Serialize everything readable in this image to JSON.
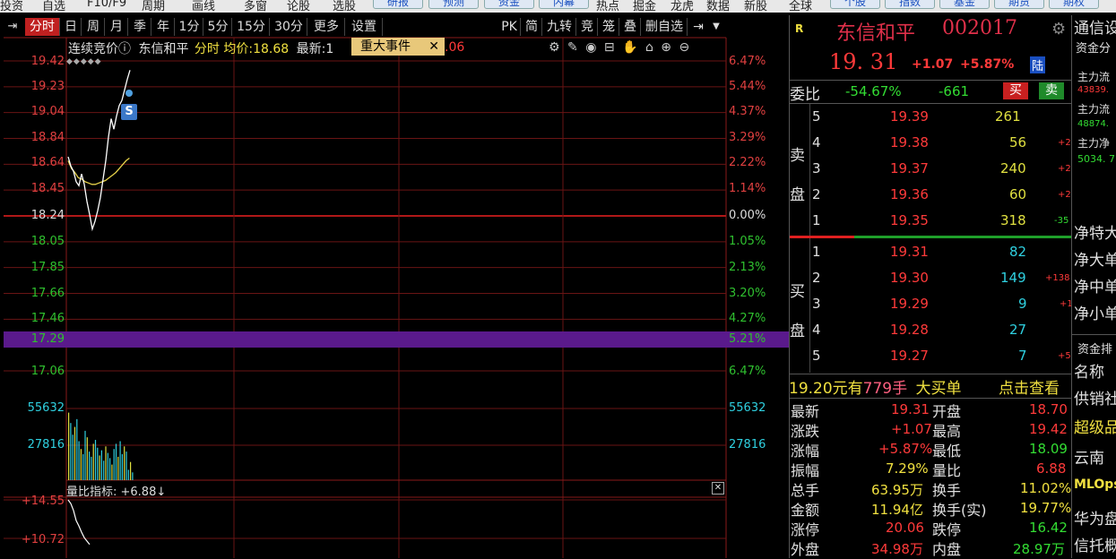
{
  "top_menu": [
    "投资",
    "自选",
    "F10/F9",
    "周期",
    "画线",
    "多窗",
    "论股",
    "选股",
    "研报",
    "预测",
    "资金",
    "内幕",
    "热点",
    "掘金",
    "龙虎",
    "数据",
    "新股",
    "全球",
    "个股",
    "指数",
    "基金",
    "期货",
    "期权"
  ],
  "toolbar": {
    "pin_icon": "pin-icon",
    "items": [
      "分时",
      "日",
      "周",
      "月",
      "季",
      "年",
      "1分",
      "5分",
      "15分",
      "30分",
      "更多",
      "设置"
    ],
    "right_items": [
      "PK",
      "简",
      "九转",
      "竞",
      "笼",
      "叠",
      "删自选"
    ],
    "export_icon": "export-icon",
    "dropdown_icon": "chevron-down-icon"
  },
  "chart_header": {
    "mode_label": "连续竞价",
    "name": "东信和平",
    "period": "分时",
    "avg_label": "均价:",
    "avg_value": "18.68",
    "latest_label": "最新:",
    "latest_value": "1",
    "event_label": "重大事件",
    "tail_value": ".06"
  },
  "chart_tools": [
    "gear-icon",
    "pen-icon",
    "eye-icon",
    "lock-open-icon",
    "hand-icon",
    "lock-icon",
    "zoom-in-icon",
    "zoom-out-icon"
  ],
  "price_axis": {
    "left": [
      "19.42",
      "19.23",
      "19.04",
      "18.84",
      "18.64",
      "18.45",
      "18.24",
      "18.05",
      "17.85",
      "17.66",
      "17.46",
      "17.29",
      "17.06"
    ],
    "right": [
      "6.47%",
      "5.44%",
      "4.37%",
      "3.29%",
      "2.22%",
      "1.14%",
      "0.00%",
      "1.05%",
      "2.13%",
      "3.20%",
      "4.27%",
      "5.21%",
      "6.47%"
    ],
    "highlight_price": "17.29",
    "highlight_pct": "5.21%"
  },
  "volume_axis": {
    "left": [
      "55632",
      "27816"
    ],
    "right": [
      "55632",
      "27816"
    ]
  },
  "indicator": {
    "label": "量比指标: +6.88",
    "arrow": "↓",
    "ticks": [
      "+14.55",
      "+10.72"
    ]
  },
  "marker_label": "S",
  "chart_data": {
    "type": "line",
    "prev_close": 18.24,
    "ylim": [
      17.06,
      19.42
    ],
    "price_series": [
      18.69,
      18.62,
      18.58,
      18.5,
      18.47,
      18.56,
      18.48,
      18.35,
      18.25,
      18.14,
      18.2,
      18.28,
      18.38,
      18.52,
      18.66,
      18.84,
      18.98,
      18.9,
      19.0,
      19.08,
      19.12,
      19.2,
      19.28,
      19.35
    ],
    "avg_series": [
      18.66,
      18.6,
      18.57,
      18.53,
      18.52,
      18.5,
      18.49,
      18.48,
      18.48,
      18.49,
      18.5,
      18.51,
      18.53,
      18.55,
      18.57,
      18.6,
      18.63,
      18.66,
      18.68
    ],
    "volume_ylim": [
      0,
      83448
    ],
    "volume": [
      52000,
      44000,
      35000,
      41000,
      47000,
      30000,
      24000,
      20000,
      38000,
      33000,
      22000,
      18000,
      28000,
      31000,
      25000,
      19000,
      23000,
      15000,
      26000,
      21000,
      17000,
      12000,
      24000,
      28000,
      18000,
      30000,
      20000,
      26000,
      22000,
      8000,
      14000,
      6000
    ],
    "ratio_series": [
      14.55,
      14.0,
      13.0,
      11.5,
      10.72,
      9.8,
      9.0,
      8.5,
      8.0
    ]
  },
  "quote": {
    "flag": "R",
    "name": "东信和平",
    "code": "002017",
    "settings_icon": "gear-icon",
    "price": "19. 31",
    "change": "+1.07",
    "change_pct": "+5.87%",
    "exchange_badge": "陆",
    "weibi_label": "委比",
    "weibi": "-54.67%",
    "weicha": "-661",
    "buy_label": "买",
    "sell_label": "卖"
  },
  "orderbook": {
    "sell_label": [
      "卖",
      "盘"
    ],
    "buy_label": [
      "买",
      "盘"
    ],
    "sell": [
      {
        "level": "5",
        "price": "19.39",
        "vol": "261",
        "delta": ""
      },
      {
        "level": "4",
        "price": "19.38",
        "vol": "56",
        "delta": "+2"
      },
      {
        "level": "3",
        "price": "19.37",
        "vol": "240",
        "delta": "+2"
      },
      {
        "level": "2",
        "price": "19.36",
        "vol": "60",
        "delta": "+2"
      },
      {
        "level": "1",
        "price": "19.35",
        "vol": "318",
        "delta": "-35"
      }
    ],
    "buy": [
      {
        "level": "1",
        "price": "19.31",
        "vol": "82",
        "delta": ""
      },
      {
        "level": "2",
        "price": "19.30",
        "vol": "149",
        "delta": "+138"
      },
      {
        "level": "3",
        "price": "19.29",
        "vol": "9",
        "delta": "+1"
      },
      {
        "level": "4",
        "price": "19.28",
        "vol": "27",
        "delta": ""
      },
      {
        "level": "5",
        "price": "19.27",
        "vol": "7",
        "delta": "+5"
      }
    ]
  },
  "big_order": {
    "price": "19.20元有",
    "qty": "779手",
    "text": "大买单",
    "link": "点击查看"
  },
  "details": [
    {
      "l1": "最新",
      "v1": "19.31",
      "l2": "开盘",
      "v2": "18.70"
    },
    {
      "l1": "涨跌",
      "v1": "+1.07",
      "l2": "最高",
      "v2": "19.42"
    },
    {
      "l1": "涨幅",
      "v1": "+5.87%",
      "l2": "最低",
      "v2": "18.09"
    },
    {
      "l1": "振幅",
      "v1": "7.29%",
      "l2": "量比",
      "v2": "6.88"
    },
    {
      "l1": "总手",
      "v1": "63.95万",
      "l2": "换手",
      "v2": "11.02%"
    },
    {
      "l1": "金额",
      "v1": "11.94亿",
      "l2": "换手(实)",
      "v2": "19.77%"
    },
    {
      "l1": "涨停",
      "v1": "20.06",
      "l2": "跌停",
      "v2": "16.42"
    },
    {
      "l1": "外盘",
      "v1": "34.98万",
      "l2": "内盘",
      "v2": "28.97万"
    }
  ],
  "far_right": {
    "title": "通信设",
    "subtitle": "资金分",
    "rows": [
      {
        "label": "主力流",
        "value": "43839."
      },
      {
        "label": "主力流",
        "value": "48874."
      },
      {
        "label": "主力净",
        "value": "5034. 7"
      }
    ],
    "net_items": [
      "净特大",
      "净大单",
      "净中单",
      "净小单"
    ],
    "section2": "资金排",
    "list_header": "名称",
    "list": [
      "供销社",
      "超级品",
      "云南",
      "MLOps",
      "华为盘",
      "信托概"
    ]
  }
}
